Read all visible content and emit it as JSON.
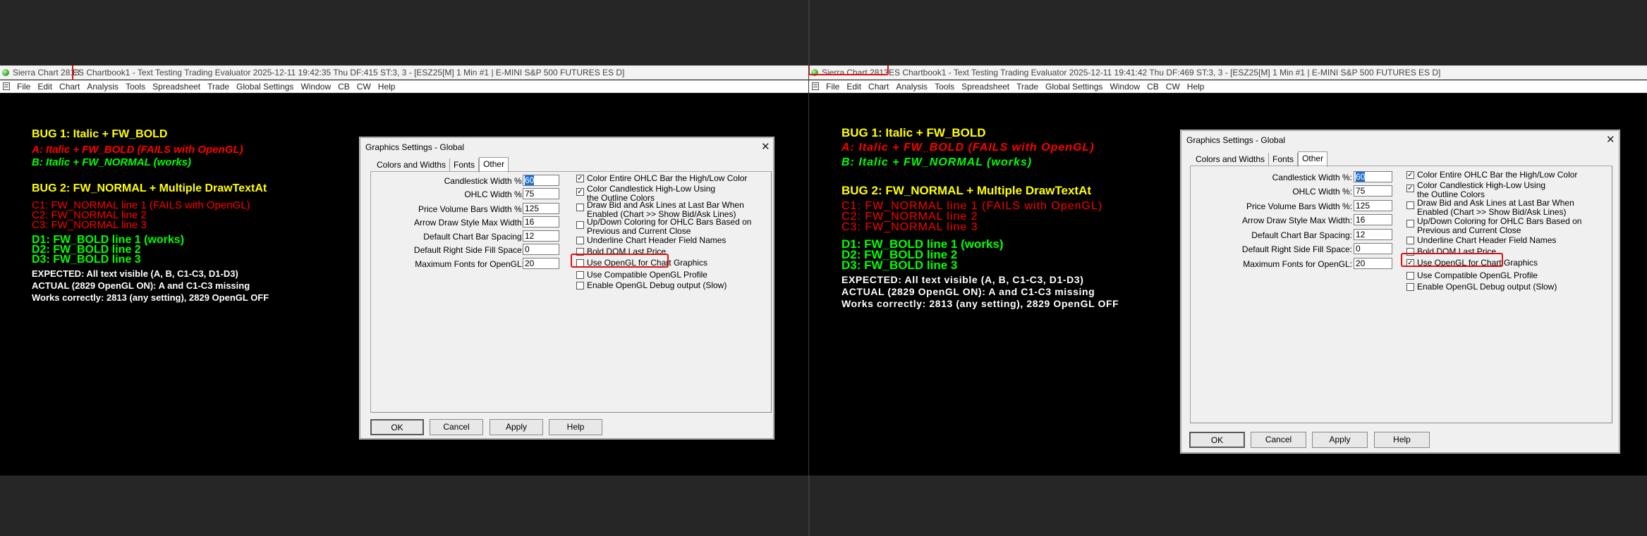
{
  "left": {
    "app_name": "Sierra Chart 2813",
    "title_rest": "ES Chartbook1 - Text Testing Trading Evaluator 2025-12-11  19:42:35 Thu DF:415  ST:3, 3 - [ESZ25[M]  1 Min  #1 | E-MINI S&P 500 FUTURES ES D]"
  },
  "right": {
    "app_name": "Sierra Chart 2813",
    "title_rest": "ES Chartbook1 - Text Testing Trading Evaluator 2025-12-11  19:41:42 Thu DF:469  ST:3, 3 - [ESZ25[M]  1 Min  #1 | E-MINI S&P 500 FUTURES ES D]"
  },
  "menu": [
    "File",
    "Edit",
    "Chart",
    "Analysis",
    "Tools",
    "Spreadsheet",
    "Trade",
    "Global Settings",
    "Window",
    "CB",
    "CW",
    "Help"
  ],
  "chart_text": {
    "bug1": "BUG 1: Italic + FW_BOLD",
    "a": "A: Italic + FW_BOLD (FAILS with OpenGL)",
    "b": "B: Italic + FW_NORMAL (works)",
    "bug2": "BUG 2: FW_NORMAL + Multiple DrawTextAt",
    "c1": "C1: FW_NORMAL line 1 (FAILS with OpenGL)",
    "c2": "C2: FW_NORMAL line 2",
    "c3": "C3: FW_NORMAL line 3",
    "d1": "D1: FW_BOLD line 1 (works)",
    "d2": "D2: FW_BOLD line 2",
    "d3": "D3: FW_BOLD line 3",
    "expected": "EXPECTED: All text visible (A, B, C1-C3, D1-D3)",
    "actual": "ACTUAL (2829 OpenGL ON): A and C1-C3 missing",
    "works": "Works correctly: 2813 (any setting), 2829 OpenGL OFF"
  },
  "colors": {
    "yellow": "#ffff00",
    "red": "#ff0000",
    "green": "#00ff00",
    "white": "#ffffff"
  },
  "dialog": {
    "title": "Graphics Settings - Global",
    "close": "✕",
    "tabs": [
      "Colors and Widths",
      "Fonts",
      "Other"
    ],
    "active_tab": "Other",
    "fields": [
      {
        "label": "Candlestick Width %:",
        "value": "60"
      },
      {
        "label": "OHLC Width %:",
        "value": "75"
      },
      {
        "label": "Price Volume Bars Width %:",
        "value": "125"
      },
      {
        "label": "Arrow Draw Style Max Width:",
        "value": "16"
      },
      {
        "label": "Default Chart Bar Spacing:",
        "value": "12"
      },
      {
        "label": "Default Right Side Fill Space:",
        "value": "0"
      },
      {
        "label": "Maximum Fonts for OpenGL:",
        "value": "20"
      }
    ],
    "checks": [
      {
        "line1": "Color Entire OHLC Bar the High/Low Color",
        "line2": ""
      },
      {
        "line1": "Color Candlestick High-Low Using",
        "line2": "the Outline Colors"
      },
      {
        "line1": "Draw Bid and Ask Lines at Last Bar When",
        "line2": "Enabled (Chart >> Show Bid/Ask Lines)"
      },
      {
        "line1": "Up/Down Coloring for OHLC Bars Based on",
        "line2": "Previous and Current Close"
      },
      {
        "line1": "Underline Chart Header Field Names",
        "line2": ""
      },
      {
        "line1": "Bold DOM Last Price",
        "line2": ""
      },
      {
        "line1": "Use OpenGL for Chart Graphics",
        "line2": ""
      },
      {
        "line1": "Use Compatible OpenGL Profile",
        "line2": ""
      },
      {
        "line1": "Enable OpenGL Debug output (Slow)",
        "line2": ""
      }
    ],
    "left_checked": [
      true,
      true,
      false,
      false,
      false,
      false,
      false,
      false,
      false
    ],
    "right_checked": [
      true,
      true,
      false,
      false,
      false,
      false,
      true,
      false,
      false
    ],
    "buttons": [
      "OK",
      "Cancel",
      "Apply",
      "Help"
    ]
  }
}
